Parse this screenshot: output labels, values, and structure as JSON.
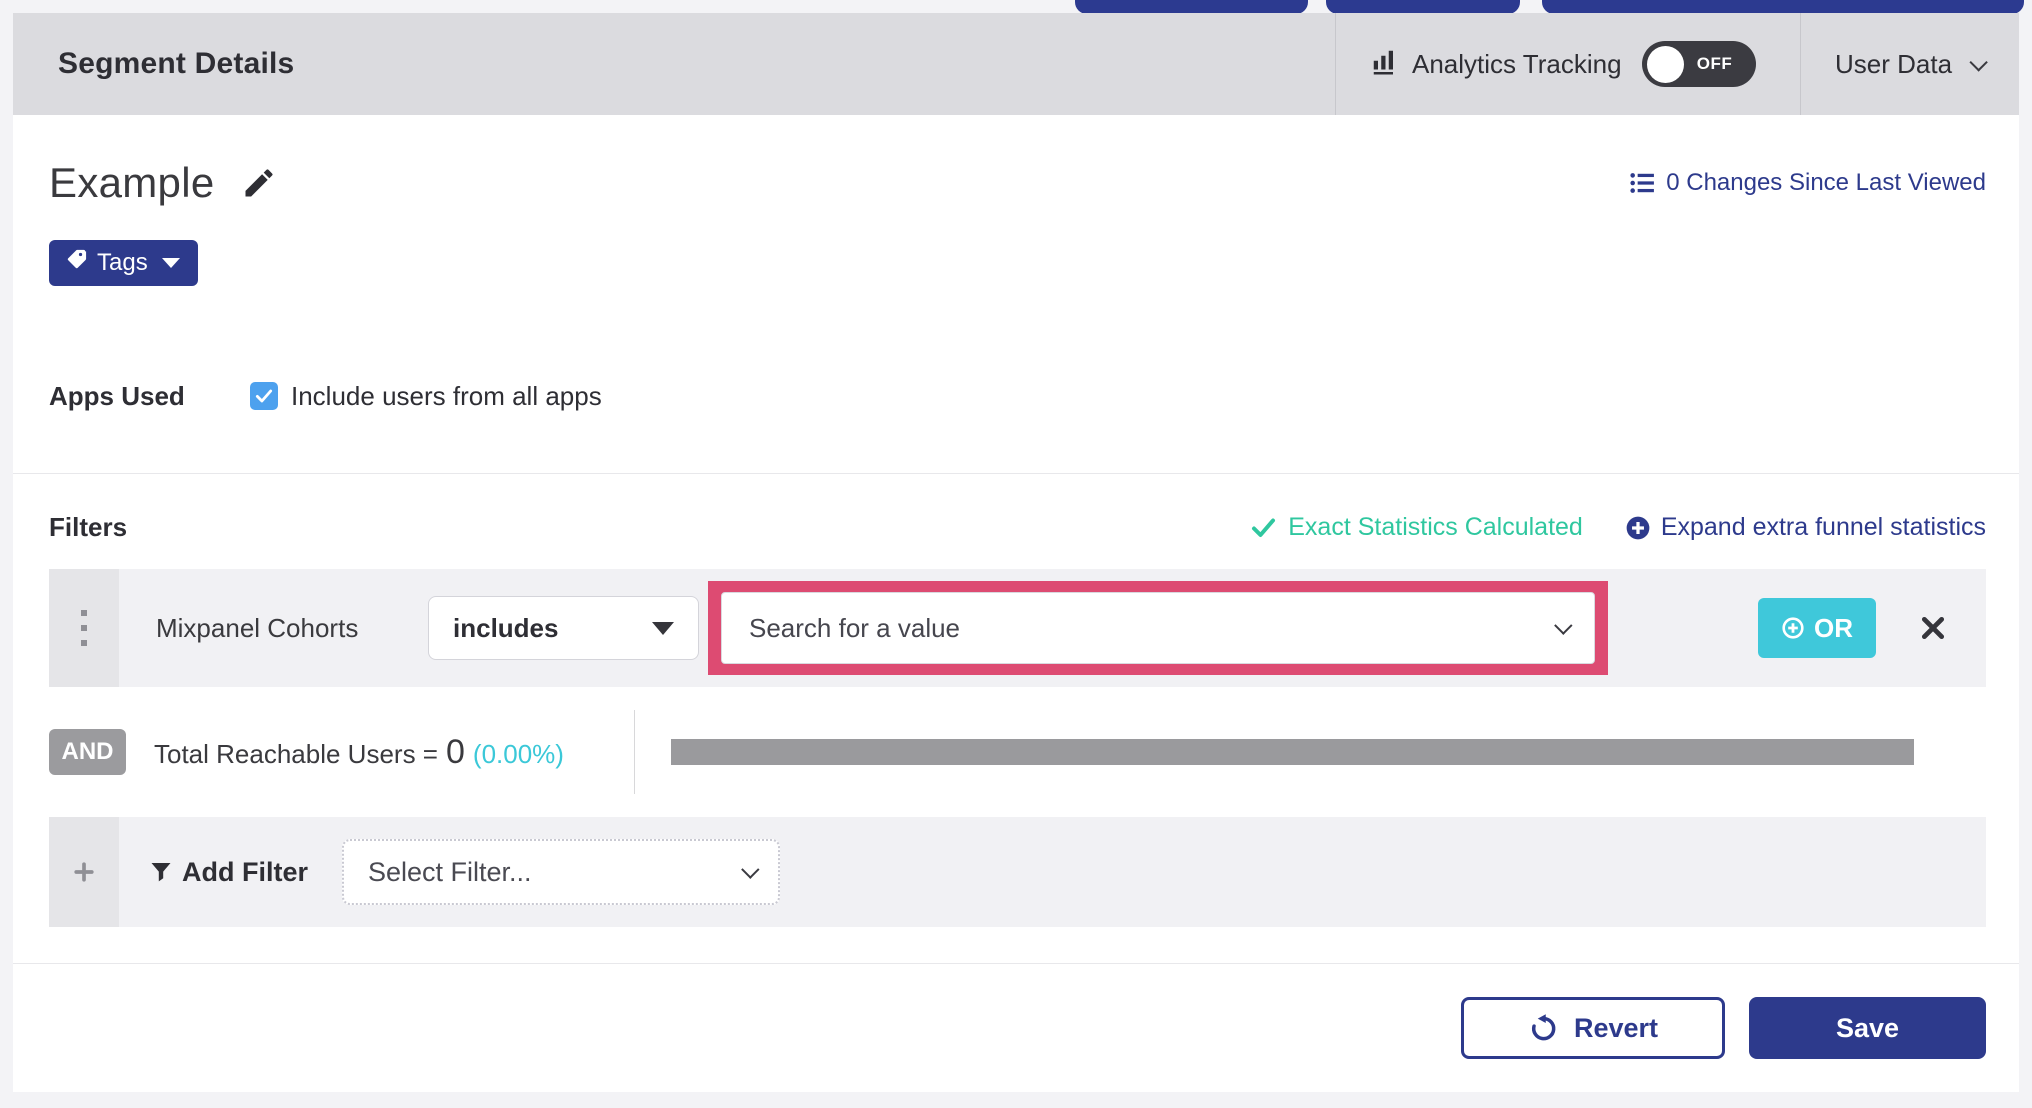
{
  "header": {
    "title": "Segment Details",
    "analytics_label": "Analytics Tracking",
    "toggle_state": "OFF",
    "user_data_label": "User Data"
  },
  "segment": {
    "name": "Example",
    "changes_link": "0 Changes Since Last Viewed",
    "tags_button": "Tags"
  },
  "apps_used": {
    "label": "Apps Used",
    "checkbox_label": "Include users from all apps",
    "checked": true
  },
  "filters": {
    "heading": "Filters",
    "exact_statistics": "Exact Statistics Calculated",
    "expand_link": "Expand extra funnel statistics",
    "row": {
      "attribute": "Mixpanel Cohorts",
      "operator": "includes",
      "value_placeholder": "Search for a value",
      "or_button": "OR"
    },
    "and_label": "AND",
    "reachable": {
      "label": "Total Reachable Users =",
      "value": "0",
      "percent": "(0.00%)"
    },
    "add": {
      "label": "Add Filter",
      "placeholder": "Select Filter..."
    }
  },
  "footer": {
    "revert": "Revert",
    "save": "Save"
  },
  "colors": {
    "indigo": "#2d3a8c",
    "teal_or_button": "#3fc8da",
    "mint_status": "#2fc79f",
    "cyan_percent": "#3bc8d8",
    "highlight_pink": "#dd4b72",
    "toggle_off_bg": "#3b3b41",
    "checkbox_blue": "#4da1ee",
    "gray_bar": "#9a9a9d"
  }
}
